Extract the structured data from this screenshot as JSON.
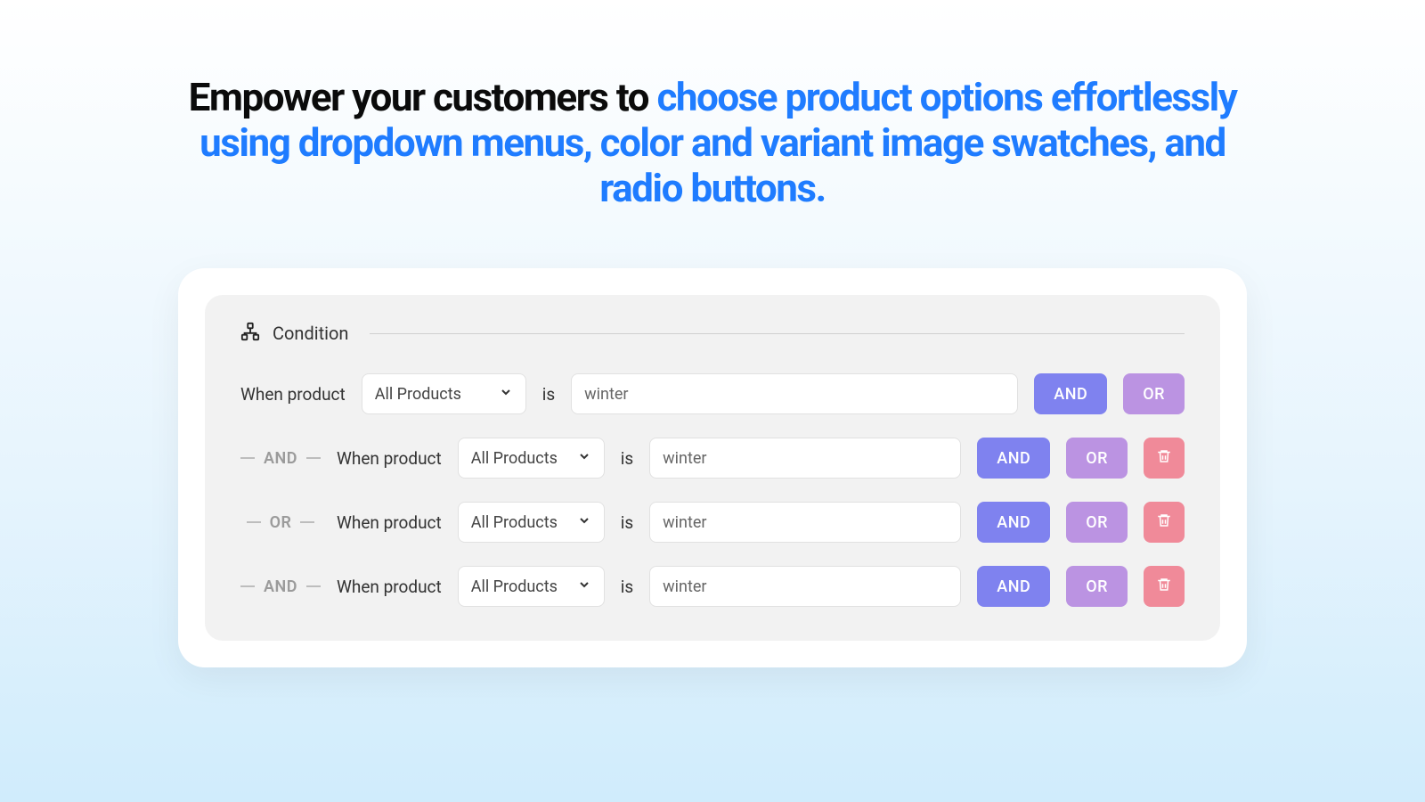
{
  "headline": {
    "dark": "Empower your customers to ",
    "blue": "choose product options effortlessly using dropdown menus, color and variant image swatches, and radio buttons."
  },
  "section": {
    "title": "Condition"
  },
  "labels": {
    "when": "When product",
    "is": "is",
    "and": "AND",
    "or": "OR"
  },
  "base": {
    "select": "All Products",
    "value": "winter"
  },
  "rows": [
    {
      "conn": "AND",
      "select": "All Products",
      "value": "winter"
    },
    {
      "conn": "OR",
      "select": "All Products",
      "value": "winter"
    },
    {
      "conn": "AND",
      "select": "All Products",
      "value": "winter"
    }
  ]
}
